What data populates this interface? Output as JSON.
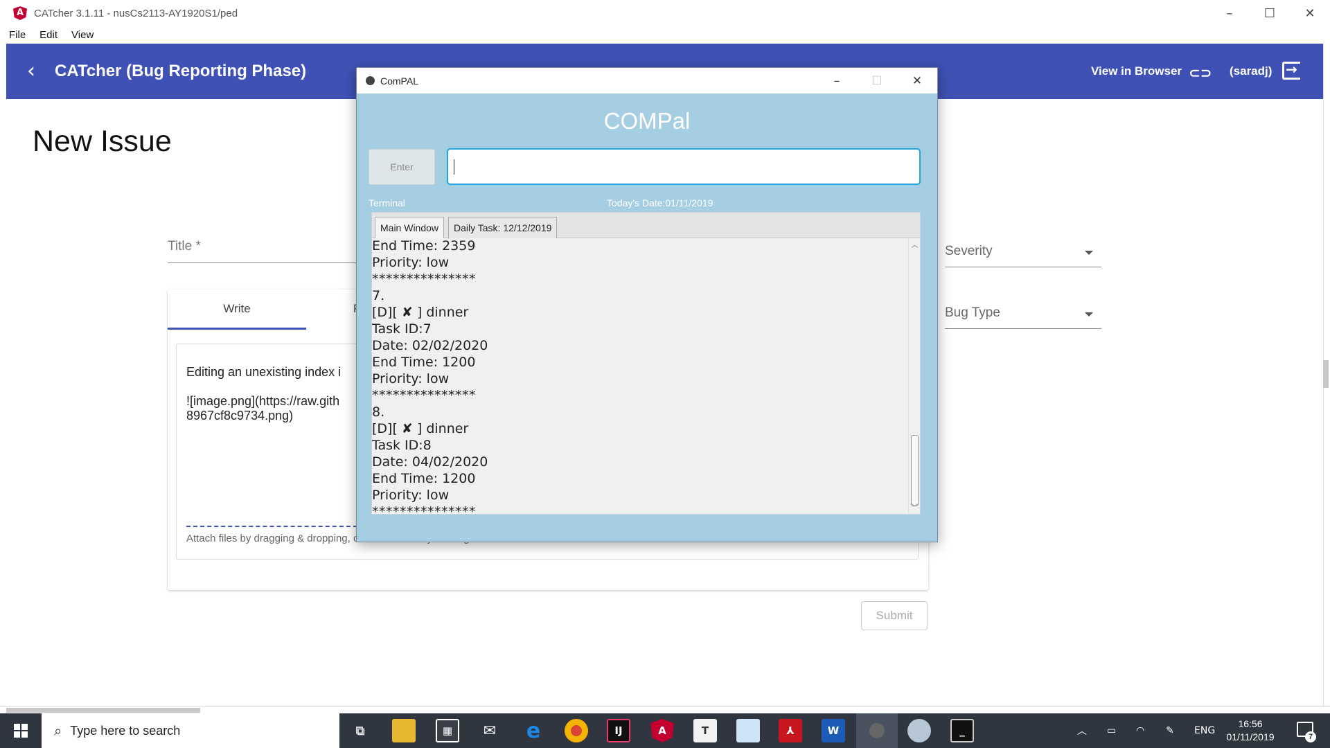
{
  "window": {
    "title": "CATcher 3.1.11 - nusCs2113-AY1920S1/ped",
    "icon_letter": "A",
    "controls": [
      "–",
      "☐",
      "✕"
    ]
  },
  "menu": [
    "File",
    "Edit",
    "View"
  ],
  "toolbar": {
    "back_icon": "‹",
    "title": "CATcher  (Bug Reporting Phase)",
    "view_in_browser": "View in Browser",
    "link_icon": "⊂⊃",
    "user": "(saradj)"
  },
  "form": {
    "heading": "New Issue",
    "title_placeholder": "Title *",
    "tab_write": "Write",
    "tab_preview": "P",
    "editor_text": "Editing an unexisting index i\n\n![image.png](https://raw.gith\n8967cf8c9734.png)",
    "drop_hint": "Attach files by dragging & dropping, or select them by clicking here.",
    "severity_label": "Severity",
    "bug_type_label": "Bug Type",
    "submit_label": "Submit"
  },
  "compal": {
    "window_title": "ComPAL",
    "controls": [
      "–",
      "☐",
      "✕"
    ],
    "heading": "COMPal",
    "enter_label": "Enter",
    "input_value": "",
    "terminal_label": "Terminal",
    "today_label": "Today's Date:01/11/2019",
    "tabs": [
      "Main Window",
      "Daily Task: 12/12/2019"
    ],
    "console_lines": [
      "End Time: 2359",
      "Priority: low",
      "***************",
      "7.",
      "[D][ ✘ ] dinner",
      "Task ID:7",
      "Date: 02/02/2020",
      "End Time: 1200",
      "Priority: low",
      "***************",
      "8.",
      "[D][ ✘ ] dinner",
      "Task ID:8",
      "Date: 04/02/2020",
      "End Time: 1200",
      "Priority: low",
      "***************"
    ]
  },
  "taskbar": {
    "search_placeholder": "Type here to search",
    "apps": [
      "task-view-icon",
      "file-explorer-icon",
      "store-icon",
      "mail-icon",
      "edge-icon",
      "chrome-icon",
      "intellij-icon",
      "angular-icon",
      "typora-icon",
      "photos-icon",
      "acrobat-icon",
      "word-icon",
      "compal-icon",
      "paint-icon",
      "terminal-icon"
    ],
    "lang": "ENG",
    "time": "16:56",
    "date": "01/11/2019",
    "notification_count": "7"
  },
  "colors": {
    "toolbar": "#3f51b5",
    "dialog_bg": "#a6cee2",
    "taskbar": "#2f3640",
    "input_focus": "#2aa3d6"
  }
}
